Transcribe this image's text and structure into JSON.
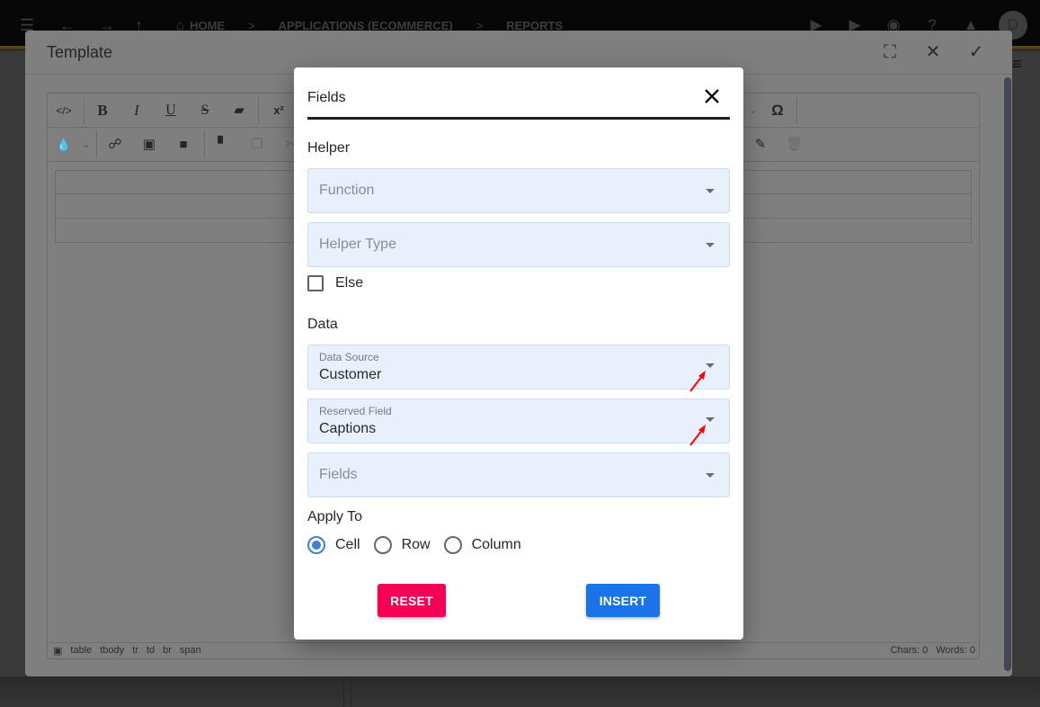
{
  "app_bar": {
    "breadcrumb": [
      "HOME",
      "APPLICATIONS (ECOMMERCE)",
      "REPORTS"
    ],
    "avatar_initial": "D",
    "icons": [
      "menu-icon",
      "back-arrow-icon",
      "forward-arrow-icon",
      "up-arrow-icon",
      "home-icon",
      "play-icon",
      "play-circle-icon",
      "robot-icon",
      "help-icon",
      "bell-icon"
    ]
  },
  "template_modal": {
    "title": "Template",
    "actions": [
      "fullscreen-icon",
      "close-icon",
      "check-icon"
    ],
    "toolbar": {
      "row1": [
        "code-view",
        "bold",
        "italic",
        "underline",
        "strikethrough",
        "clear-format",
        "superscript",
        "special-characters"
      ],
      "row1_labels": {
        "bold": "B",
        "italic": "I",
        "underline": "U",
        "strikethrough": "S",
        "superscript": "x²",
        "code": "</>",
        "omega": "Ω"
      },
      "row2": [
        "text-color",
        "link",
        "image",
        "video",
        "format-painter",
        "copy",
        "cut",
        "edit",
        "delete"
      ]
    },
    "content_rows": 3,
    "statusbar": {
      "path": [
        "table",
        "tbody",
        "tr",
        "td",
        "br",
        "span"
      ],
      "chars": "Chars: 0",
      "words": "Words: 0"
    }
  },
  "fields_dialog": {
    "title": "Fields",
    "helper_section": "Helper",
    "function_placeholder": "Function",
    "helper_type_placeholder": "Helper Type",
    "else_label": "Else",
    "else_checked": false,
    "data_section": "Data",
    "data_source": {
      "label": "Data Source",
      "value": "Customer"
    },
    "reserved_field": {
      "label": "Reserved Field",
      "value": "Captions"
    },
    "fields_placeholder": "Fields",
    "apply_to_section": "Apply To",
    "apply_to_options": [
      {
        "label": "Cell",
        "checked": true
      },
      {
        "label": "Row",
        "checked": false
      },
      {
        "label": "Column",
        "checked": false
      }
    ],
    "reset_label": "RESET",
    "insert_label": "INSERT",
    "colors": {
      "reset": "#f50057",
      "insert": "#1a73e8",
      "select_bg": "#e7f0fb",
      "radio_checked": "#3b82d6",
      "annotation_arrow": "#ff0000"
    }
  }
}
